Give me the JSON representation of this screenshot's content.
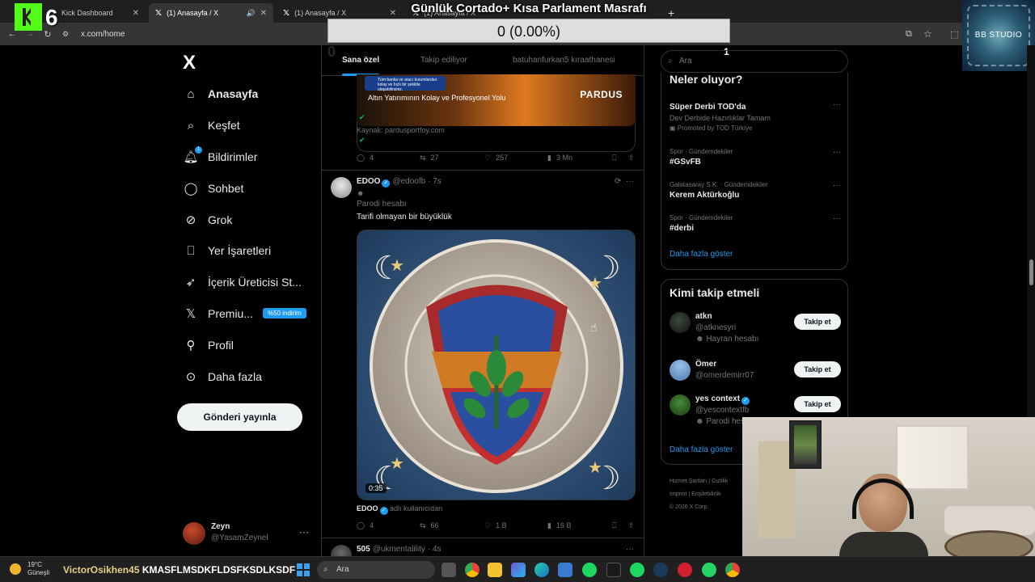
{
  "browser": {
    "tabs": [
      {
        "label": "Kick Dashboard",
        "active": false
      },
      {
        "label": "(1) Anasayfa / X",
        "active": true
      },
      {
        "label": "(1) Anasayfa / X",
        "active": false
      },
      {
        "label": "(1) Anasayfa / X",
        "active": false
      }
    ],
    "url": "x.com/home",
    "new_tab": "+"
  },
  "overlay": {
    "k6_digit": "6",
    "title": "Günlük Cortado+ Kısa Parlament Masrafı",
    "progress_text": "0 (0.00%)",
    "progress": 0,
    "counter_left": "0",
    "counter_right": "1",
    "studio_label": "BB STUDIO"
  },
  "sidebar": {
    "logo": "X",
    "items": [
      {
        "label": "Anasayfa",
        "icon": "home-icon"
      },
      {
        "label": "Keşfet",
        "icon": "search-icon"
      },
      {
        "label": "Bildirimler",
        "icon": "bell-icon",
        "badge": "1"
      },
      {
        "label": "Sohbet",
        "icon": "chat-icon"
      },
      {
        "label": "Grok",
        "icon": "grok-icon"
      },
      {
        "label": "Yer İşaretleri",
        "icon": "bookmark-icon"
      },
      {
        "label": "İçerik Üreticisi St...",
        "icon": "rocket-icon"
      },
      {
        "label": "Premiu...",
        "icon": "x-icon",
        "pill": "%50 indirim"
      },
      {
        "label": "Profil",
        "icon": "person-icon"
      },
      {
        "label": "Daha fazla",
        "icon": "more-circle-icon"
      }
    ],
    "post_button": "Gönderi yayınla",
    "user": {
      "name": "Zeyn",
      "handle": "@YasamZeynel"
    }
  },
  "feed": {
    "tabs": [
      "Sana özel",
      "Takip ediliyor",
      "batuhanfurkan5 kıraathanesi"
    ],
    "ad": {
      "note": "Tüm banka ve aracı kurumlardan kolay ve hızlı bir şekilde ulaşabilirsiniz.",
      "caption": "Altın Yatırımının Kolay ve Profesyonel Yolu",
      "brand": "PARDUS",
      "source": "Kaynak: pardusportfoy.com"
    },
    "post1_stats": {
      "replies": "4",
      "reposts": "27",
      "likes": "257",
      "views": "3 Mn"
    },
    "post2": {
      "name": "EDOO",
      "handle": "@edoofb",
      "time": "· 7s",
      "label": "Parodi hesabı",
      "text": "Tarifi olmayan bir büyüklük",
      "video_time": "0:35",
      "credit_name": "EDOO",
      "credit_suffix": "adlı kullanıcıdan",
      "stats": {
        "replies": "4",
        "reposts": "66",
        "likes": "1 B",
        "views": "16 B"
      }
    },
    "post3": {
      "name": "505",
      "handle": "@ukmentalility",
      "time": "· 4s"
    }
  },
  "right": {
    "search_placeholder": "Ara",
    "trends_title": "Neler oluyor?",
    "trends": [
      {
        "meta": "",
        "title": "Süper Derbi TOD'da",
        "sub": "Dev Derbide Hazırlıklar Tamam",
        "promo": "Promoted by TOD Türkiye"
      },
      {
        "meta": "Spor · Gündemdekiler",
        "title": "#GSvFB",
        "sub": "",
        "promo": ""
      },
      {
        "meta": "Galatasaray S.K. · Gündemdekiler",
        "title": "Kerem Aktürkoğlu",
        "sub": "",
        "promo": ""
      },
      {
        "meta": "Spor · Gündemdekiler",
        "title": "#derbi",
        "sub": "",
        "promo": ""
      }
    ],
    "show_more": "Daha fazla göster",
    "follow_title": "Kimi takip etmeli",
    "follow": [
      {
        "name": "atkn",
        "handle": "@atknesyri",
        "extra": "Hayran hesabı",
        "button": "Takip et"
      },
      {
        "name": "Ömer",
        "handle": "@omerdemirr07",
        "extra": "",
        "button": "Takip et"
      },
      {
        "name": "yes context",
        "handle": "@yescontextfb",
        "extra": "Parodi hesabı",
        "button": "Takip et"
      }
    ],
    "show_more2": "Daha fazla göster",
    "footer": [
      "Hizmet Şartları",
      "Gizlilik",
      "İmprint",
      "Erişilebilirlik",
      "© 2026 X Corp."
    ]
  },
  "taskbar": {
    "temp": "19°C",
    "weather": "Güneşli",
    "ticker_user": "VictorOsikhen45",
    "ticker_text": "KMASFLMSDKFLDSFKSDLKSDF",
    "search": "Ara"
  }
}
